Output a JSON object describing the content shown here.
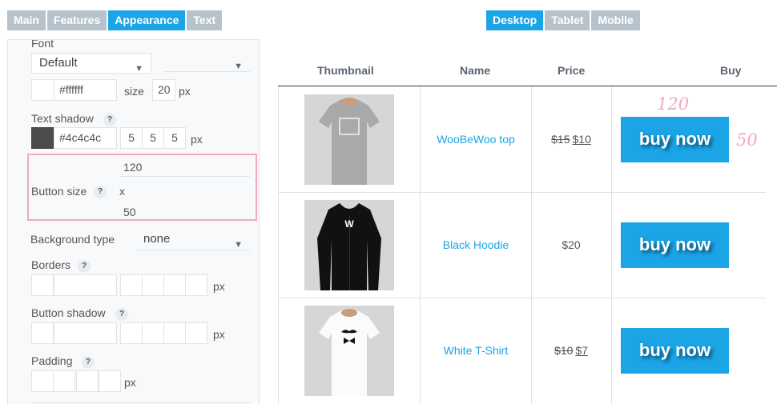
{
  "tabs_left": [
    "Main",
    "Features",
    "Appearance",
    "Text"
  ],
  "tabs_right": [
    "Desktop",
    "Tablet",
    "Mobile"
  ],
  "colors": {
    "accent": "#1ba4e6",
    "tab_inactive": "#b6c3cc",
    "highlight": "#f2a7c3",
    "shadow_swatch": "#4c4c4c"
  },
  "panel": {
    "font_label": "Font",
    "font_value": "Default",
    "font_color": "#ffffff",
    "size_label": "size",
    "size_value": "20",
    "px": "px",
    "text_shadow_label": "Text shadow",
    "shadow_color": "#4c4c4c",
    "shadow_values": [
      "5",
      "5",
      "5"
    ],
    "button_size_label": "Button size",
    "button_width": "120",
    "x_label": "x",
    "button_height": "50",
    "bg_type_label": "Background type",
    "bg_type_value": "none",
    "borders_label": "Borders",
    "button_shadow_label": "Button shadow",
    "padding_label": "Padding",
    "help": "?"
  },
  "table": {
    "headers": [
      "Thumbnail",
      "Name",
      "Price",
      "Buy"
    ],
    "rows": [
      {
        "name": "WooBeWoo top",
        "old_price": "$15",
        "price": "$10",
        "buy": "buy now",
        "shirt": "grey-tshirt-icon"
      },
      {
        "name": "Black Hoodie",
        "old_price": "",
        "price": "$20",
        "buy": "buy now",
        "shirt": "black-hoodie-icon"
      },
      {
        "name": "White T-Shirt",
        "old_price": "$10",
        "price": "$7",
        "buy": "buy now",
        "shirt": "white-tshirt-icon"
      }
    ]
  },
  "annotations": {
    "width": "120",
    "height": "50"
  }
}
